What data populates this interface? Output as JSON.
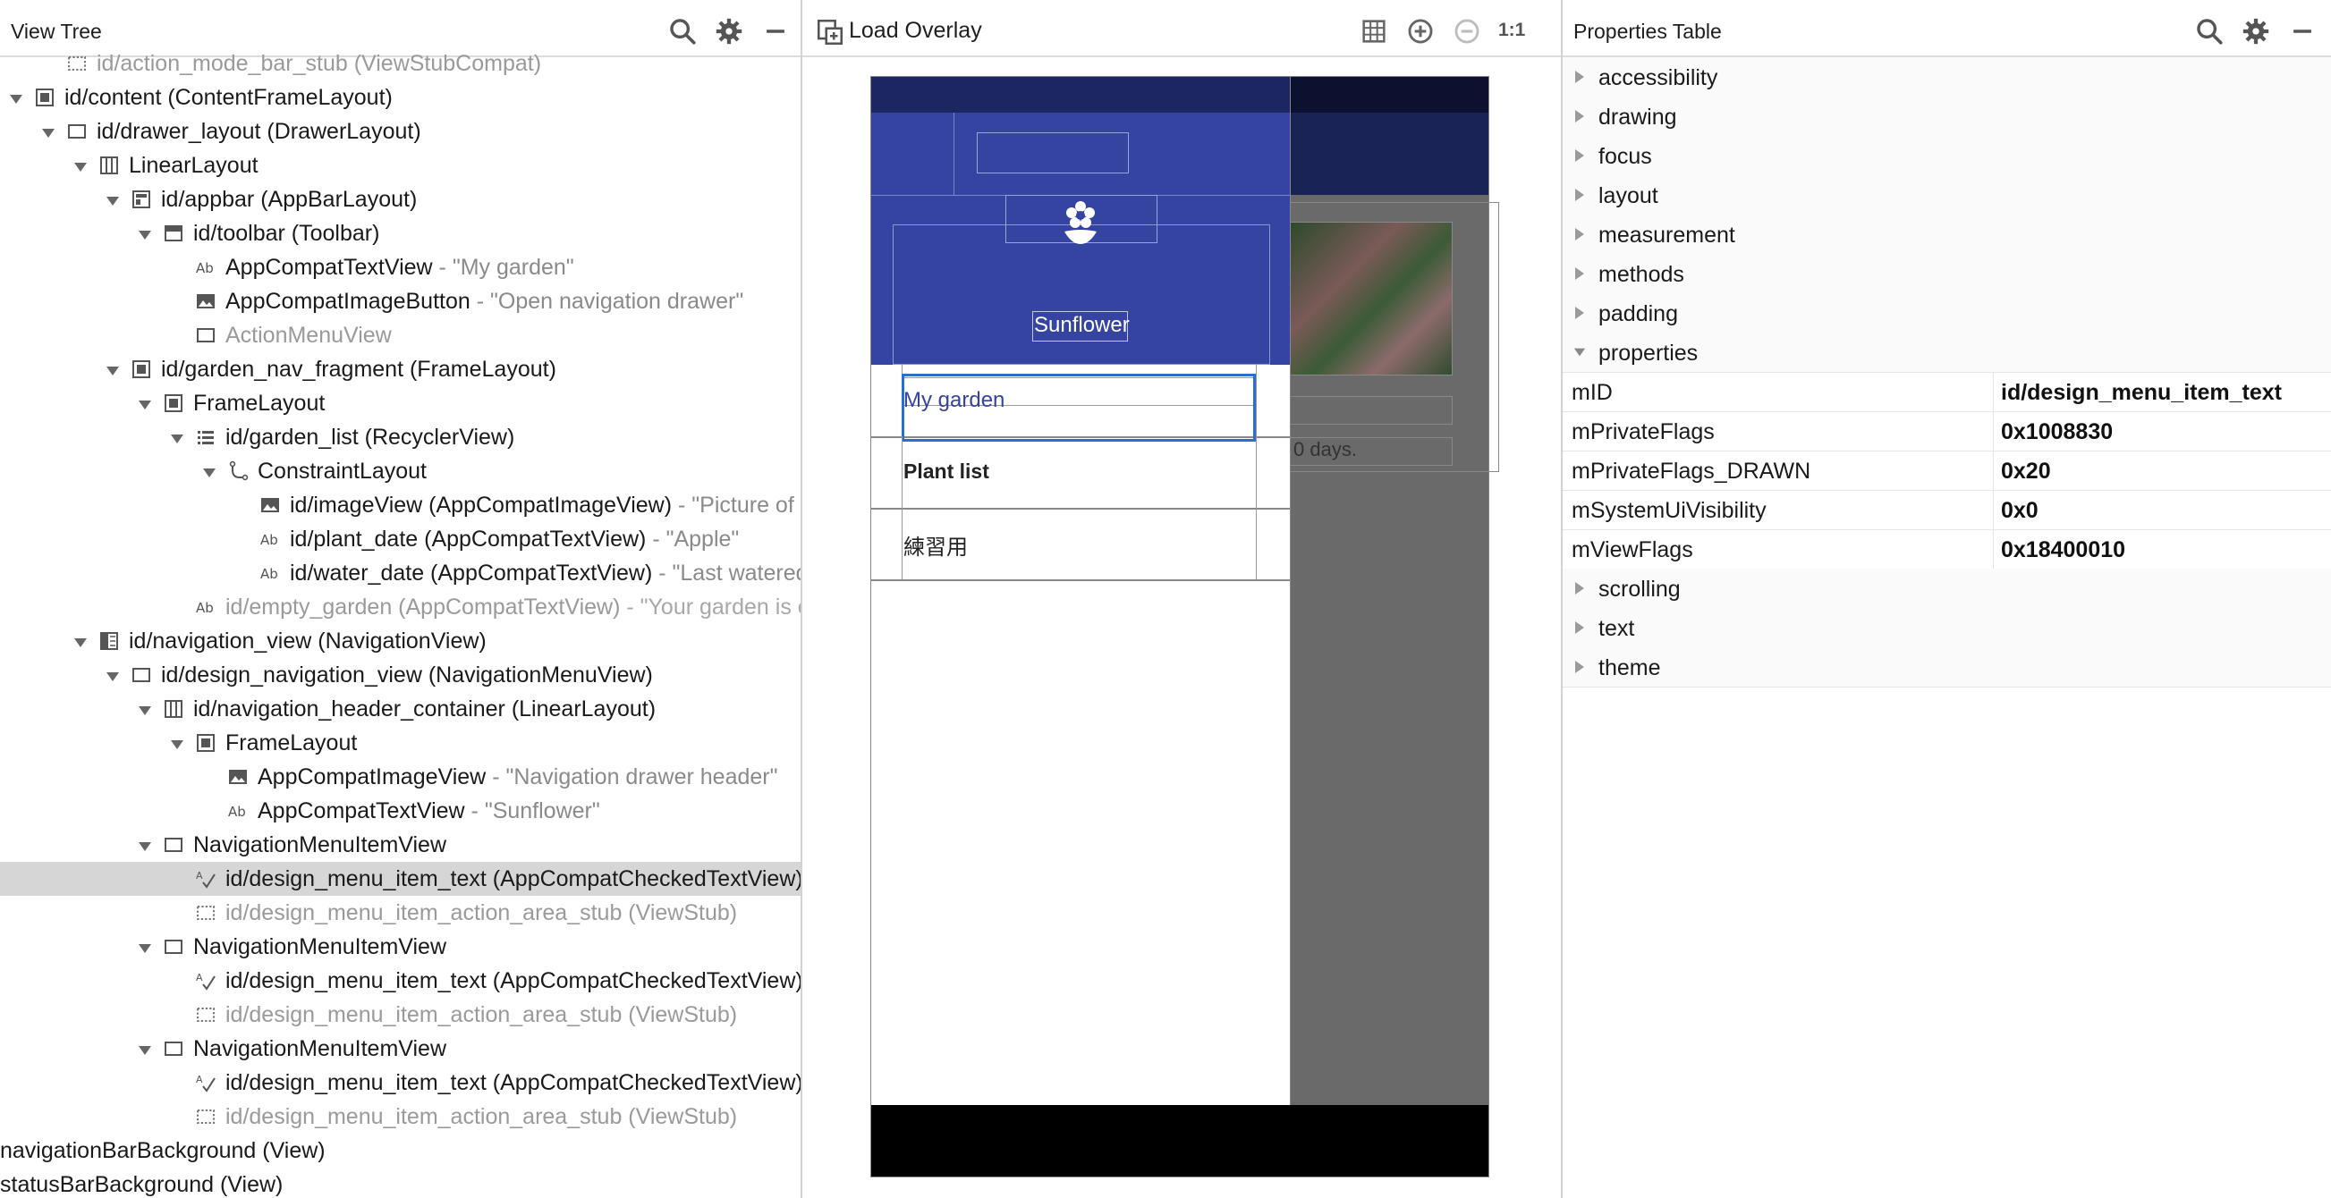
{
  "view_tree": {
    "title": "View Tree",
    "rows": [
      {
        "text": "id/action_mode_bar_stub (ViewStubCompat)",
        "desc": "",
        "dim": true,
        "level": 1,
        "arrow": "none",
        "icon": "viewstub-icon"
      },
      {
        "text": "id/content (ContentFrameLayout)",
        "desc": "",
        "dim": false,
        "level": 0,
        "arrow": "down",
        "icon": "frame-icon"
      },
      {
        "text": "id/drawer_layout (DrawerLayout)",
        "desc": "",
        "dim": false,
        "level": 1,
        "arrow": "down",
        "icon": "view-icon"
      },
      {
        "text": "LinearLayout",
        "desc": "",
        "dim": false,
        "level": 2,
        "arrow": "down",
        "icon": "linear-layout-icon"
      },
      {
        "text": "id/appbar (AppBarLayout)",
        "desc": "",
        "dim": false,
        "level": 3,
        "arrow": "down",
        "icon": "appbar-icon"
      },
      {
        "text": "id/toolbar (Toolbar)",
        "desc": "",
        "dim": false,
        "level": 4,
        "arrow": "down",
        "icon": "toolbar-icon"
      },
      {
        "text": "AppCompatTextView",
        "desc": " - \"My garden\"",
        "dim": false,
        "level": 5,
        "arrow": "none",
        "icon": "textview-icon"
      },
      {
        "text": "AppCompatImageButton",
        "desc": " - \"Open navigation drawer\"",
        "dim": false,
        "level": 5,
        "arrow": "none",
        "icon": "image-icon"
      },
      {
        "text": "ActionMenuView",
        "desc": "",
        "dim": true,
        "level": 5,
        "arrow": "none",
        "icon": "view-icon"
      },
      {
        "text": "id/garden_nav_fragment (FrameLayout)",
        "desc": "",
        "dim": false,
        "level": 3,
        "arrow": "down",
        "icon": "frame-icon"
      },
      {
        "text": "FrameLayout",
        "desc": "",
        "dim": false,
        "level": 4,
        "arrow": "down",
        "icon": "frame-icon"
      },
      {
        "text": "id/garden_list (RecyclerView)",
        "desc": "",
        "dim": false,
        "level": 5,
        "arrow": "down",
        "icon": "list-icon"
      },
      {
        "text": "ConstraintLayout",
        "desc": "",
        "dim": false,
        "level": 6,
        "arrow": "down",
        "icon": "constraint-icon"
      },
      {
        "text": "id/imageView (AppCompatImageView)",
        "desc": " - \"Picture of plant\"",
        "dim": false,
        "level": 7,
        "arrow": "none",
        "icon": "image-icon"
      },
      {
        "text": "id/plant_date (AppCompatTextView)",
        "desc": " - \"Apple\"",
        "dim": false,
        "level": 7,
        "arrow": "none",
        "icon": "textview-icon"
      },
      {
        "text": "id/water_date (AppCompatTextView)",
        "desc": " - \"Last watered\"",
        "dim": false,
        "level": 7,
        "arrow": "none",
        "icon": "textview-icon"
      },
      {
        "text": "id/empty_garden (AppCompatTextView)",
        "desc": " - \"Your garden is empty\"",
        "dim": true,
        "level": 5,
        "arrow": "none",
        "icon": "textview-icon"
      },
      {
        "text": "id/navigation_view (NavigationView)",
        "desc": "",
        "dim": false,
        "level": 2,
        "arrow": "down",
        "icon": "navview-icon"
      },
      {
        "text": "id/design_navigation_view (NavigationMenuView)",
        "desc": "",
        "dim": false,
        "level": 3,
        "arrow": "down",
        "icon": "view-icon"
      },
      {
        "text": "id/navigation_header_container (LinearLayout)",
        "desc": "",
        "dim": false,
        "level": 4,
        "arrow": "down",
        "icon": "linear-layout-icon"
      },
      {
        "text": "FrameLayout",
        "desc": "",
        "dim": false,
        "level": 5,
        "arrow": "down",
        "icon": "frame-icon"
      },
      {
        "text": "AppCompatImageView",
        "desc": " - \"Navigation drawer header\"",
        "dim": false,
        "level": 6,
        "arrow": "none",
        "icon": "image-icon"
      },
      {
        "text": "AppCompatTextView",
        "desc": " - \"Sunflower\"",
        "dim": false,
        "level": 6,
        "arrow": "none",
        "icon": "textview-icon"
      },
      {
        "text": "NavigationMenuItemView",
        "desc": "",
        "dim": false,
        "level": 4,
        "arrow": "down",
        "icon": "view-icon"
      },
      {
        "text": "id/design_menu_item_text (AppCompatCheckedTextView)",
        "desc": "",
        "dim": false,
        "level": 5,
        "arrow": "none",
        "icon": "checked-text-icon",
        "selected": true
      },
      {
        "text": "id/design_menu_item_action_area_stub (ViewStub)",
        "desc": "",
        "dim": true,
        "level": 5,
        "arrow": "none",
        "icon": "viewstub-icon"
      },
      {
        "text": "NavigationMenuItemView",
        "desc": "",
        "dim": false,
        "level": 4,
        "arrow": "down",
        "icon": "view-icon"
      },
      {
        "text": "id/design_menu_item_text (AppCompatCheckedTextView)",
        "desc": "",
        "dim": false,
        "level": 5,
        "arrow": "none",
        "icon": "checked-text-icon"
      },
      {
        "text": "id/design_menu_item_action_area_stub (ViewStub)",
        "desc": "",
        "dim": true,
        "level": 5,
        "arrow": "none",
        "icon": "viewstub-icon"
      },
      {
        "text": "NavigationMenuItemView",
        "desc": "",
        "dim": false,
        "level": 4,
        "arrow": "down",
        "icon": "view-icon"
      },
      {
        "text": "id/design_menu_item_text (AppCompatCheckedTextView)",
        "desc": "",
        "dim": false,
        "level": 5,
        "arrow": "none",
        "icon": "checked-text-icon"
      },
      {
        "text": "id/design_menu_item_action_area_stub (ViewStub)",
        "desc": "",
        "dim": true,
        "level": 5,
        "arrow": "none",
        "icon": "viewstub-icon"
      },
      {
        "text": "navigationBarBackground (View)",
        "desc": "",
        "dim": false,
        "level": -1,
        "arrow": "none",
        "icon": ""
      },
      {
        "text": "statusBarBackground (View)",
        "desc": "",
        "dim": false,
        "level": -1,
        "arrow": "none",
        "icon": ""
      }
    ]
  },
  "overlay": {
    "title": "Load Overlay",
    "zoom_label": "1:1",
    "app": {
      "header_label": "Sunflower",
      "menu_items": [
        "My garden",
        "Plant list",
        "練習用"
      ],
      "behind_text": "0 days."
    }
  },
  "properties": {
    "title": "Properties Table",
    "categories_before": [
      "accessibility",
      "drawing",
      "focus",
      "layout",
      "measurement",
      "methods",
      "padding",
      "properties"
    ],
    "entries": [
      {
        "name": "mID",
        "value": "id/design_menu_item_text"
      },
      {
        "name": "mPrivateFlags",
        "value": "0x1008830"
      },
      {
        "name": "mPrivateFlags_DRAWN",
        "value": "0x20"
      },
      {
        "name": "mSystemUiVisibility",
        "value": "0x0"
      },
      {
        "name": "mViewFlags",
        "value": "0x18400010"
      }
    ],
    "categories_after": [
      "scrolling",
      "text",
      "theme"
    ]
  },
  "colors": {
    "app_primary": "#3444a0",
    "app_dark": "#1c2660",
    "selection_outline": "#2a6fd0",
    "tree_selection": "#d6d6d6",
    "device_backdrop": "#6a6a6a"
  }
}
